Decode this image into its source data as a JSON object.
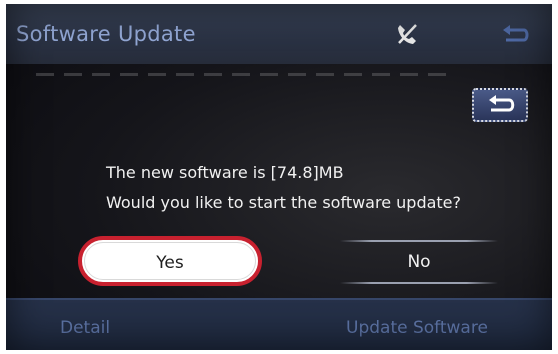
{
  "header": {
    "title": "Software Update",
    "status_icon": "phone-disabled-icon",
    "back_icon": "return-arrow-icon"
  },
  "dialog": {
    "back_icon": "return-arrow-icon",
    "message_line1": "The new software is [74.8]MB",
    "message_line2": "Would you like to start the software update?",
    "yes_label": "Yes",
    "no_label": "No"
  },
  "footer": {
    "detail_label": "Detail",
    "update_label": "Update Software"
  },
  "colors": {
    "title_text": "#93a8d6",
    "yes_border": "#c8212f",
    "footer_text": "#5d74a6"
  }
}
